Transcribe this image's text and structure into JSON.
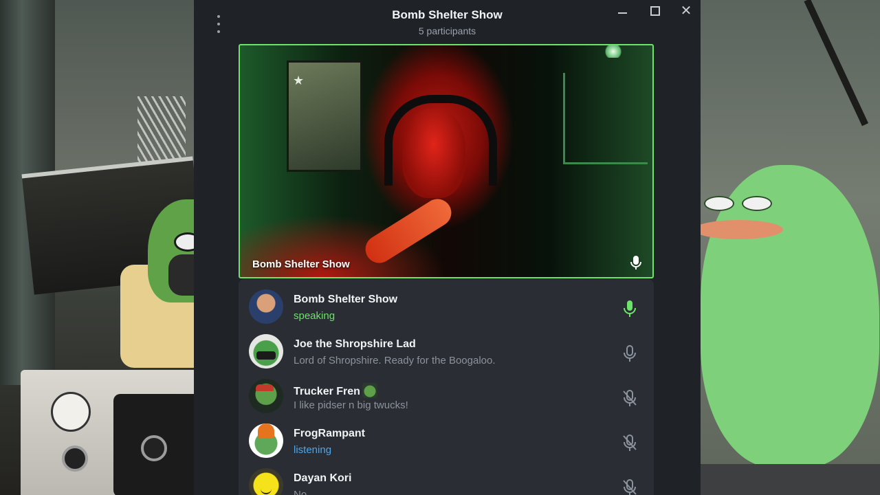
{
  "window": {
    "title": "Bomb Shelter Show",
    "subtitle": "5 participants"
  },
  "video": {
    "name": "Bomb Shelter Show",
    "speaking_border_color": "#6ee36a"
  },
  "participants": [
    {
      "name": "Bomb Shelter Show",
      "status": "speaking",
      "status_type": "speaking",
      "mic": "mic-active-icon"
    },
    {
      "name": "Joe the Shropshire Lad",
      "status": "Lord of Shropshire. Ready for the Boogaloo.",
      "status_type": "bio",
      "mic": "mic-icon"
    },
    {
      "name": "Trucker Fren",
      "status": "I like pidser n big twucks!",
      "status_type": "bio",
      "mic": "mic-muted-icon"
    },
    {
      "name": "FrogRampant",
      "status": "listening",
      "status_type": "listening",
      "mic": "mic-muted-icon"
    },
    {
      "name": "Dayan Kori",
      "status": "No",
      "status_type": "bio",
      "mic": "mic-muted-icon"
    }
  ],
  "colors": {
    "window_bg": "#1f2227",
    "list_bg": "#2a2d33",
    "speaking": "#6ee36a",
    "listening": "#4ea6e8",
    "muted_text": "#8b939c"
  }
}
